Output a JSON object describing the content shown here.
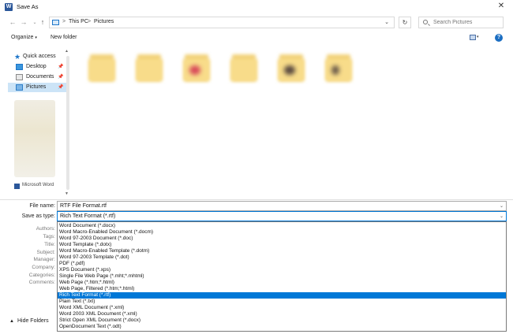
{
  "window": {
    "title": "Save As",
    "app_icon": "W"
  },
  "address": {
    "crumbs": [
      "This PC",
      "Pictures"
    ],
    "separator": ">",
    "search_placeholder": "Search Pictures"
  },
  "toolbar": {
    "organize": "Organize",
    "new_folder": "New folder",
    "help": "?"
  },
  "nav": {
    "items": [
      {
        "label": "Quick access",
        "pinned": false
      },
      {
        "label": "Desktop",
        "pinned": true
      },
      {
        "label": "Documents",
        "pinned": true
      },
      {
        "label": "Pictures",
        "pinned": true,
        "selected": true
      }
    ],
    "bottom_item": "Microsoft Word"
  },
  "form": {
    "file_name_label": "File name:",
    "file_name_value": "RTF File Format.rtf",
    "save_as_type_label": "Save as type:",
    "save_as_type_value": "Rich Text Format (*.rtf)",
    "meta_labels": [
      "Authors:",
      "Tags:",
      "Title:",
      "Subject:",
      "Manager:",
      "Company:",
      "Categories:",
      "Comments:"
    ]
  },
  "file_types": [
    "Word Document (*.docx)",
    "Word Macro-Enabled Document (*.docm)",
    "Word 97-2003 Document (*.doc)",
    "Word Template (*.dotx)",
    "Word Macro-Enabled Template (*.dotm)",
    "Word 97-2003 Template (*.dot)",
    "PDF (*.pdf)",
    "XPS Document (*.xps)",
    "Single File Web Page (*.mht;*.mhtml)",
    "Web Page (*.htm;*.html)",
    "Web Page, Filtered (*.htm;*.html)",
    "Rich Text Format (*.rtf)",
    "Plain Text (*.txt)",
    "Word XML Document (*.xml)",
    "Word 2003 XML Document (*.xml)",
    "Strict Open XML Document (*.docx)",
    "OpenDocument Text (*.odt)"
  ],
  "selected_file_type_index": 11,
  "footer": {
    "hide_folders": "Hide Folders"
  },
  "colors": {
    "accent": "#0078d7",
    "folder": "#f8dc8a",
    "selection": "#cce4f7"
  }
}
